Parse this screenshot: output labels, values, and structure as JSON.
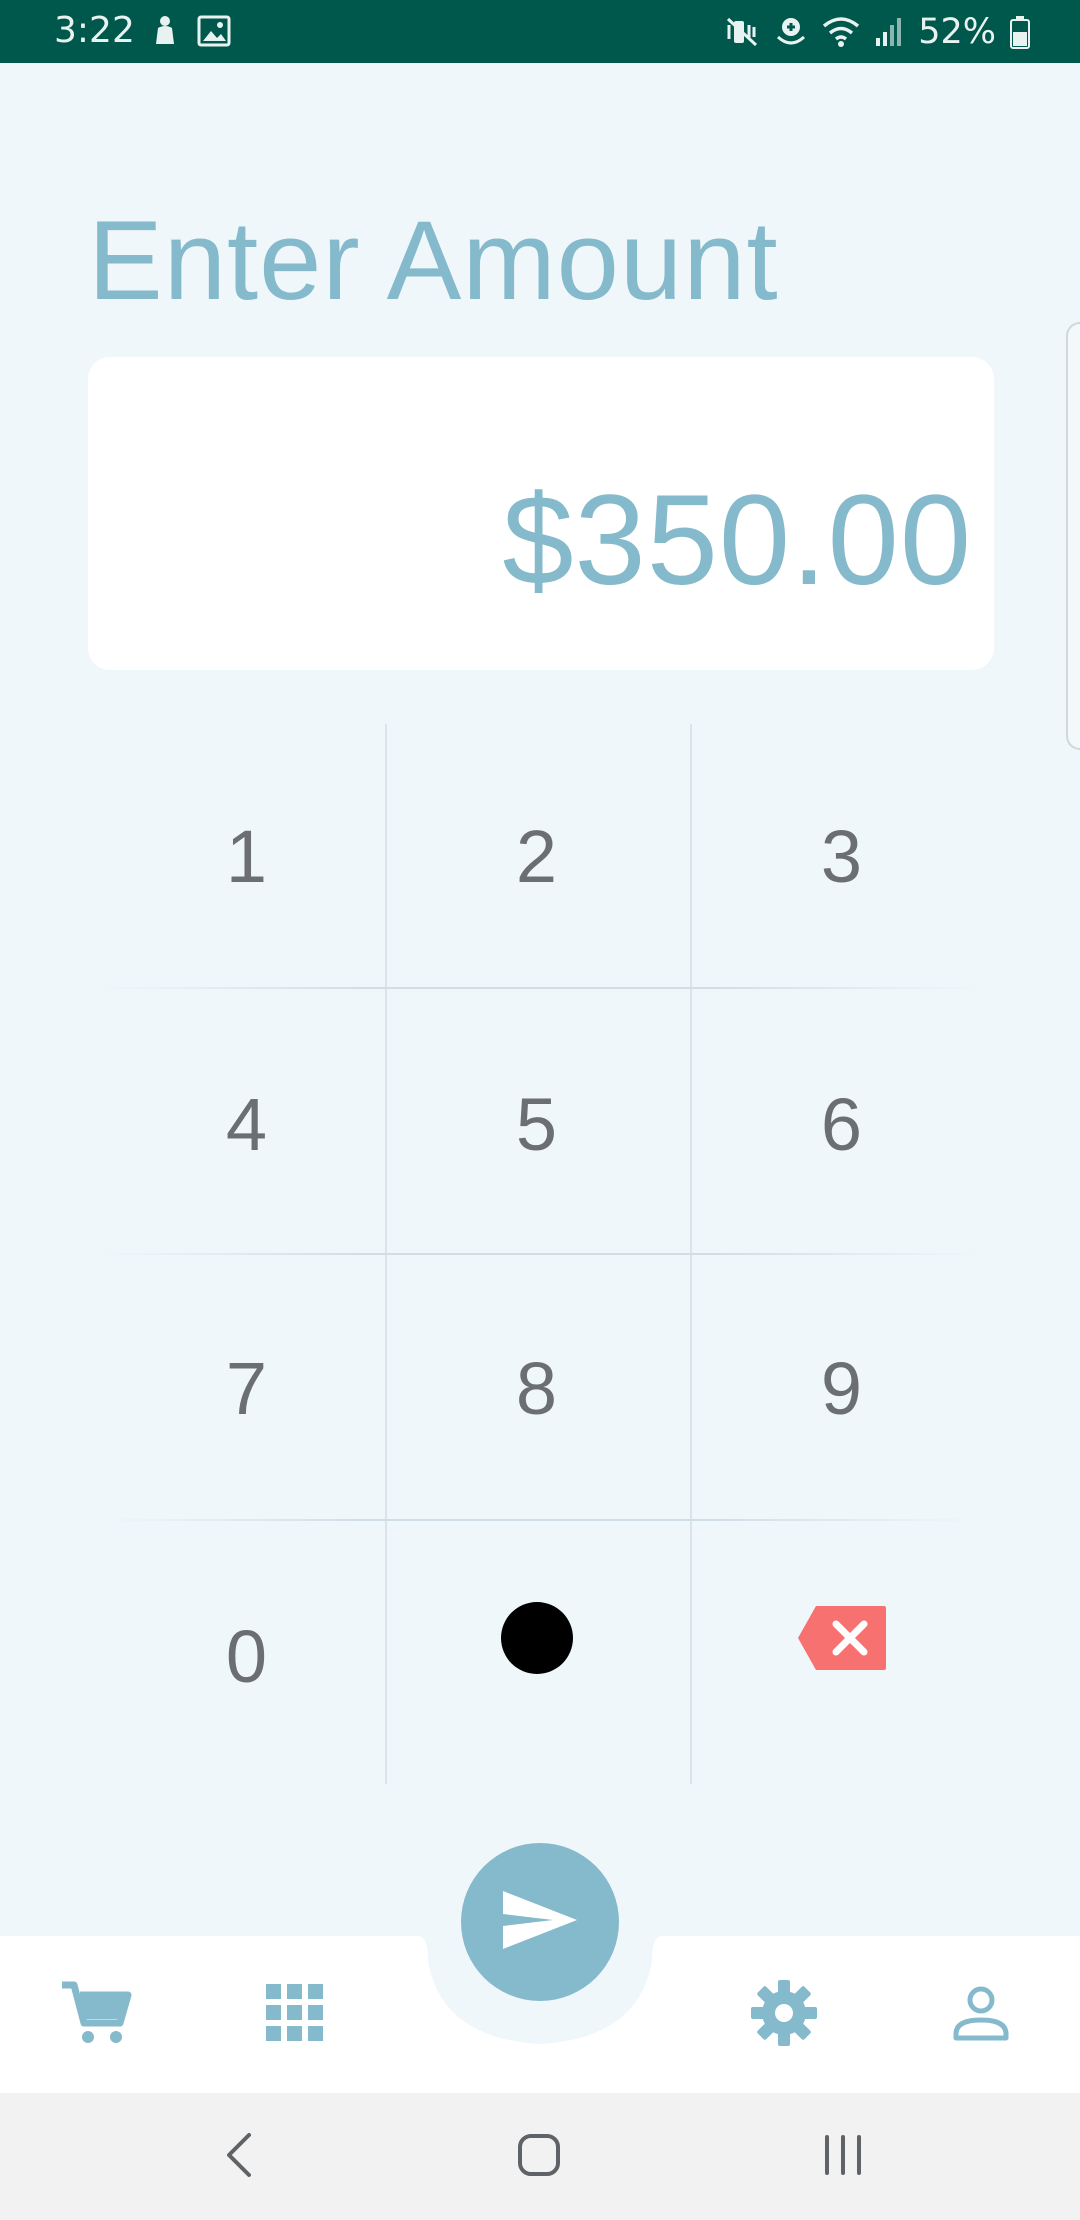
{
  "status_bar": {
    "time": "3:22",
    "battery": "52%",
    "background": "#00574b",
    "icons": [
      "baby-icon",
      "image-icon",
      "mute-vibrate-icon",
      "hotspot-icon",
      "wifi-icon",
      "signal-icon",
      "battery-icon"
    ]
  },
  "page": {
    "title": "Enter Amount",
    "amount": "$350.00",
    "accent_color": "#85b9cc"
  },
  "keypad": {
    "keys": [
      "1",
      "2",
      "3",
      "4",
      "5",
      "6",
      "7",
      "8",
      "9",
      "0"
    ],
    "decimal_key_icon": "dot-icon",
    "delete_key_icon": "backspace-icon",
    "delete_color": "#f87171"
  },
  "bottom_nav": {
    "items": [
      "cart-icon",
      "grid-icon",
      "send-icon",
      "settings-icon",
      "profile-icon"
    ]
  },
  "system_nav": {
    "items": [
      "back-icon",
      "home-icon",
      "recents-icon"
    ]
  }
}
